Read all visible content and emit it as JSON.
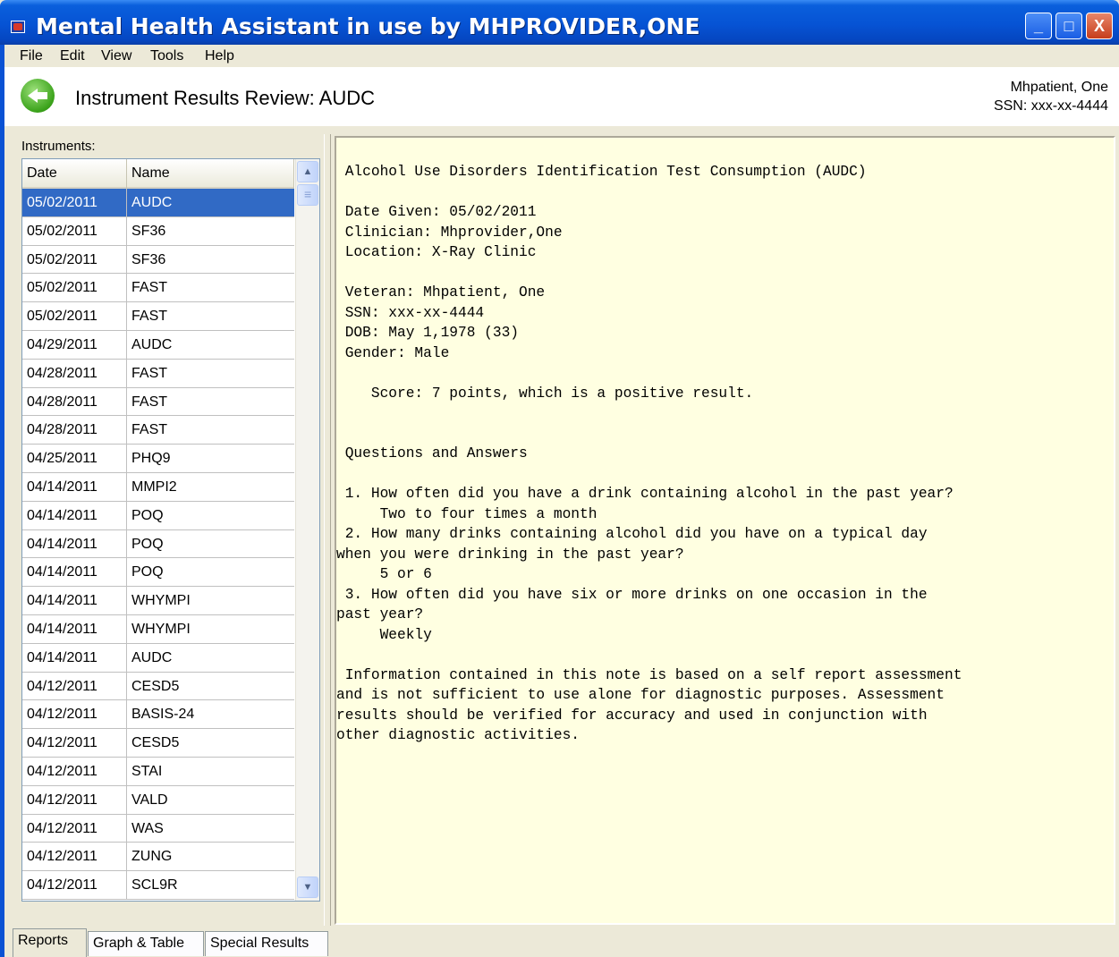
{
  "window": {
    "title": "Mental Health Assistant in use by MHPROVIDER,ONE",
    "minimize": "_",
    "maximize": "□",
    "close": "X"
  },
  "menu": [
    "File",
    "Edit",
    "View",
    "Tools",
    "Help"
  ],
  "header": {
    "title": "Instrument Results Review: AUDC",
    "patient_name": "Mhpatient, One",
    "patient_ssn": "SSN: xxx-xx-4444"
  },
  "instruments": {
    "label": "Instruments:",
    "columns": [
      "Date",
      "Name"
    ],
    "selected_index": 0,
    "rows": [
      {
        "date": "05/02/2011",
        "name": "AUDC"
      },
      {
        "date": "05/02/2011",
        "name": "SF36"
      },
      {
        "date": "05/02/2011",
        "name": "SF36"
      },
      {
        "date": "05/02/2011",
        "name": "FAST"
      },
      {
        "date": "05/02/2011",
        "name": "FAST"
      },
      {
        "date": "04/29/2011",
        "name": "AUDC"
      },
      {
        "date": "04/28/2011",
        "name": "FAST"
      },
      {
        "date": "04/28/2011",
        "name": "FAST"
      },
      {
        "date": "04/28/2011",
        "name": "FAST"
      },
      {
        "date": "04/25/2011",
        "name": "PHQ9"
      },
      {
        "date": "04/14/2011",
        "name": "MMPI2"
      },
      {
        "date": "04/14/2011",
        "name": "POQ"
      },
      {
        "date": "04/14/2011",
        "name": "POQ"
      },
      {
        "date": "04/14/2011",
        "name": "POQ"
      },
      {
        "date": "04/14/2011",
        "name": "WHYMPI"
      },
      {
        "date": "04/14/2011",
        "name": "WHYMPI"
      },
      {
        "date": "04/14/2011",
        "name": "AUDC"
      },
      {
        "date": "04/12/2011",
        "name": "CESD5"
      },
      {
        "date": "04/12/2011",
        "name": "BASIS-24"
      },
      {
        "date": "04/12/2011",
        "name": "CESD5"
      },
      {
        "date": "04/12/2011",
        "name": "STAI"
      },
      {
        "date": "04/12/2011",
        "name": "VALD"
      },
      {
        "date": "04/12/2011",
        "name": "WAS"
      },
      {
        "date": "04/12/2011",
        "name": "ZUNG"
      },
      {
        "date": "04/12/2011",
        "name": "SCL9R"
      }
    ]
  },
  "report": {
    "text": " Alcohol Use Disorders Identification Test Consumption (AUDC)\n\n Date Given: 05/02/2011\n Clinician: Mhprovider,One\n Location: X-Ray Clinic\n\n Veteran: Mhpatient, One\n SSN: xxx-xx-4444\n DOB: May 1,1978 (33)\n Gender: Male\n\n    Score: 7 points, which is a positive result.\n\n\n Questions and Answers\n\n 1. How often did you have a drink containing alcohol in the past year?\n     Two to four times a month\n 2. How many drinks containing alcohol did you have on a typical day\nwhen you were drinking in the past year?\n     5 or 6\n 3. How often did you have six or more drinks on one occasion in the\npast year?\n     Weekly\n\n Information contained in this note is based on a self report assessment\nand is not sufficient to use alone for diagnostic purposes. Assessment\nresults should be verified for accuracy and used in conjunction with\nother diagnostic activities."
  },
  "tabs": [
    "Reports",
    "Graph & Table",
    "Special Results"
  ],
  "active_tab": 0,
  "colors": {
    "title_bar": "#0653d4",
    "selection": "#316ac5",
    "report_bg": "#ffffe1"
  }
}
